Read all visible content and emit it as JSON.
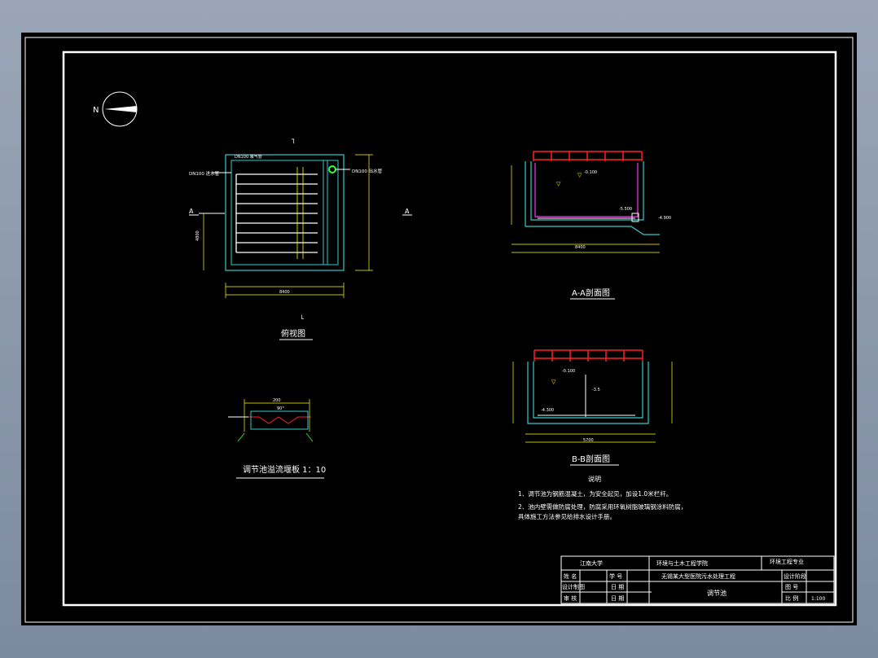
{
  "drawing": {
    "plan": {
      "title": "俯视图",
      "section_a_left": "A",
      "section_a_right": "A",
      "pipe_left": "DN100 进水管",
      "pipe_right": "DN100 出水管",
      "dim_total": "8400",
      "dim_height": "4800"
    },
    "section_aa": {
      "title": "A-A剖面图",
      "level_water": "-0.100",
      "level_bottom": "-5.500",
      "level_side": "-4.900",
      "dim_span": "8400"
    },
    "section_bb": {
      "title": "B-B剖面图",
      "level_water": "-0.100",
      "level_mid": "-3.5",
      "level_bottom": "-4.300",
      "dim_span": "5700"
    },
    "weir": {
      "title": "调节池溢流堰板 1：10",
      "dim": "200",
      "angle": "90°"
    },
    "notes": {
      "heading": "说明",
      "items": [
        "1、调节池为钢筋混凝土，为安全起见，加设1.0米栏杆。",
        "2、池内壁需做防腐处理，防腐采用环氧树脂玻璃钢涂料防腐，",
        "   具体施工方法参见给排水设计手册。"
      ]
    },
    "north": "N"
  },
  "title_block": {
    "school": "江南大学",
    "college": "环境与土木工程学院",
    "major": "环境工程专业",
    "project": "无锡某大型医院污水处理工程",
    "drawing_name": "调节池",
    "label_name": "姓 名",
    "label_id": "学 号",
    "label_designer": "设计制图",
    "label_reviewer": "审 核",
    "label_date": "日 期",
    "label_drawing_no": "图 号",
    "label_scale": "比 例",
    "label_design_phase": "设计阶段",
    "scale_value": "1:100"
  },
  "colors": {
    "frame": "#ffffff",
    "concrete": "#33cccc",
    "railing": "#ff2020",
    "pipe": "#ff33ff",
    "dimension": "#ffff00",
    "text": "#ffffff",
    "green": "#33ff33"
  }
}
